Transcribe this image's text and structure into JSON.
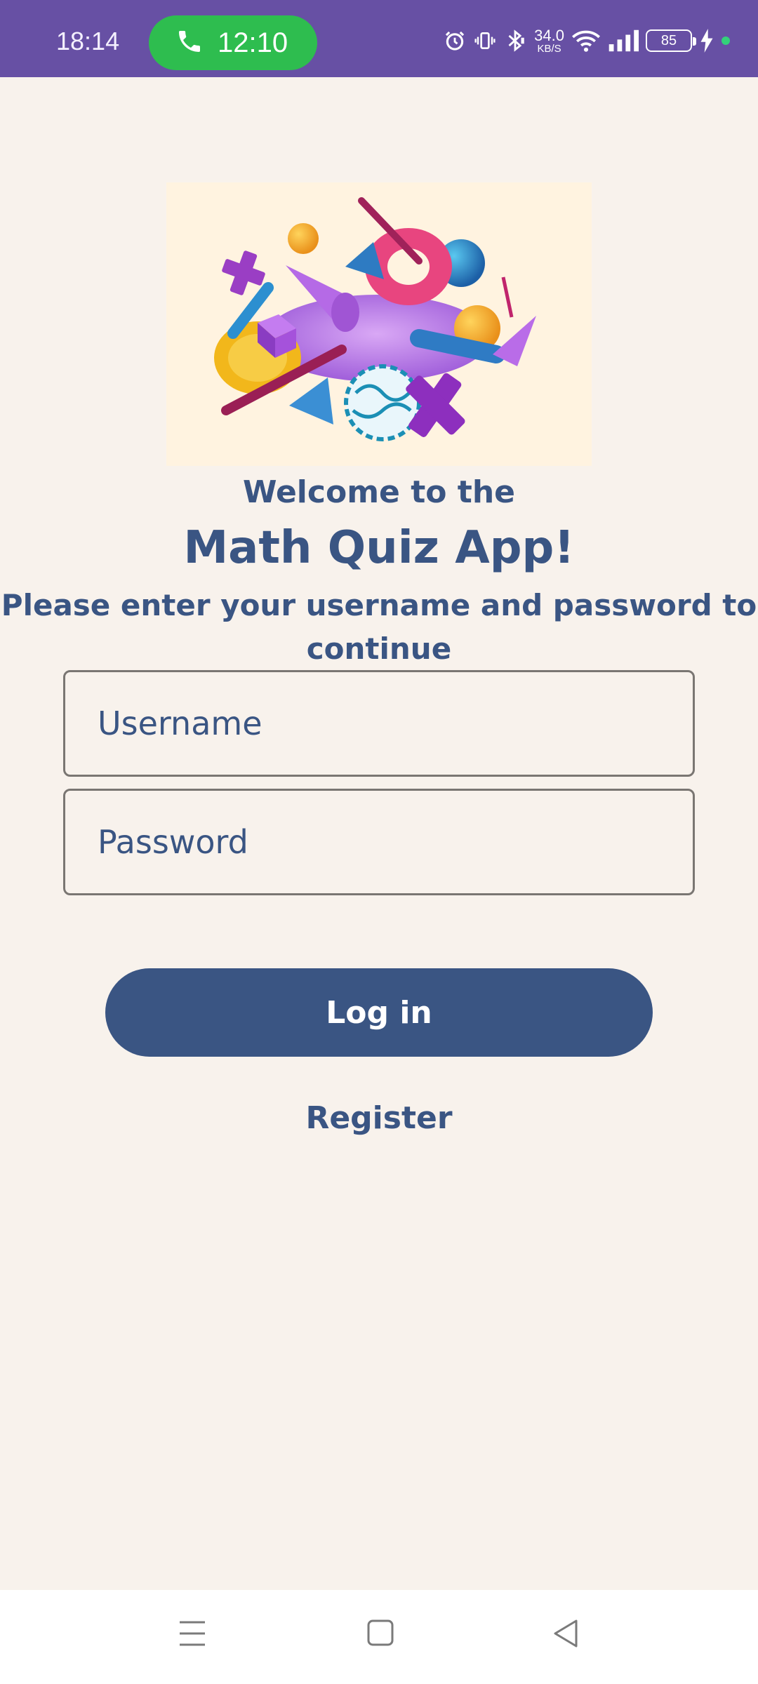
{
  "status_bar": {
    "time": "18:14",
    "call_duration": "12:10",
    "net_speed_value": "34.0",
    "net_speed_unit": "KB/S",
    "battery": "85"
  },
  "welcome": {
    "line1": "Welcome to the",
    "title": "Math Quiz App!",
    "instructions": "Please enter your username and password to continue"
  },
  "form": {
    "username_placeholder": "Username",
    "password_placeholder": "Password",
    "login_label": "Log in",
    "register_label": "Register"
  },
  "colors": {
    "status_bar": "#6750a4",
    "background": "#f8f2ec",
    "primary": "#3a5583",
    "call_pill": "#2ebd4f"
  }
}
